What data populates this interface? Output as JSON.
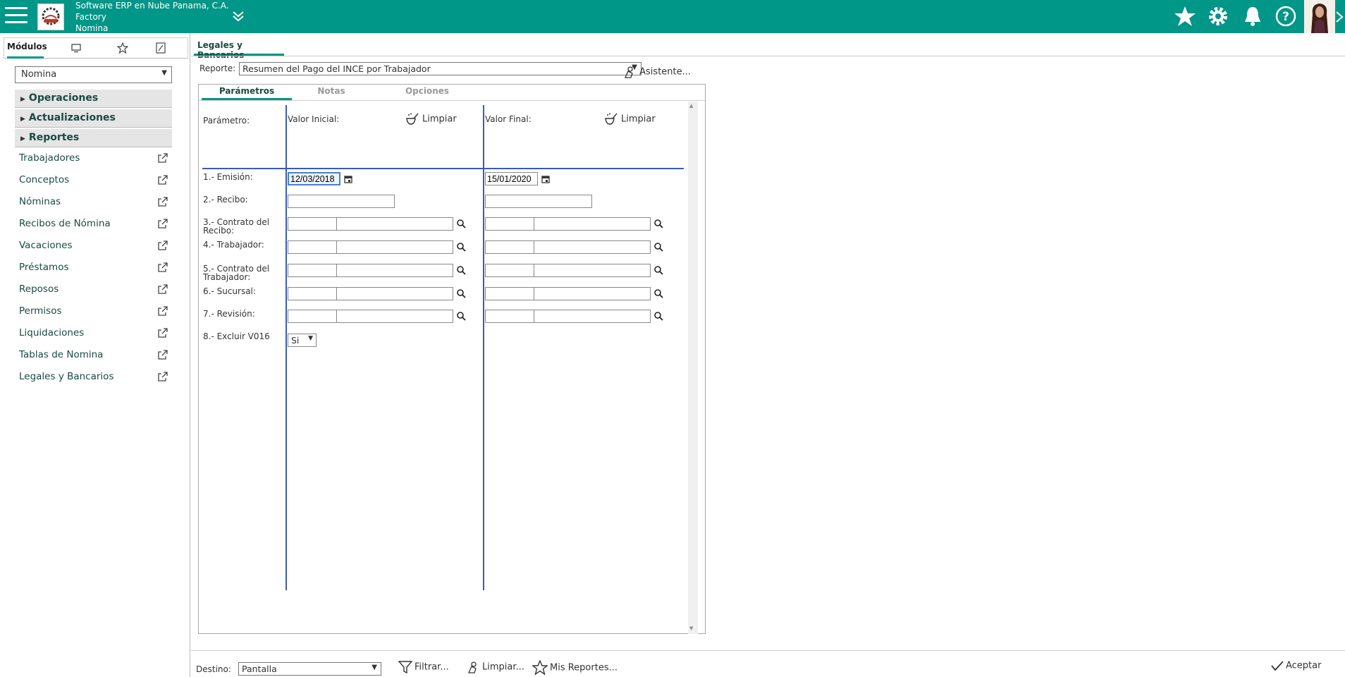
{
  "header": {
    "company_line1": "Software ERP en Nube Panama, C.A.",
    "company_line2": "Factory",
    "company_line3": "Nomina",
    "accent": "#009688"
  },
  "sidebar": {
    "tabs": [
      "Módulos",
      "monitor-icon",
      "star-icon",
      "edit-icon"
    ],
    "active_tab_label": "Módulos",
    "module_select": "Nomina",
    "sections": [
      "Operaciones",
      "Actualizaciones",
      "Reportes"
    ],
    "items": [
      {
        "label": "Trabajadores"
      },
      {
        "label": "Conceptos"
      },
      {
        "label": "Nóminas"
      },
      {
        "label": "Recibos de Nómina"
      },
      {
        "label": "Vacaciones"
      },
      {
        "label": "Préstamos"
      },
      {
        "label": "Reposos"
      },
      {
        "label": "Permisos"
      },
      {
        "label": "Liquidaciones"
      },
      {
        "label": "Tablas de Nomina"
      },
      {
        "label": "Legales y Bancarios"
      }
    ]
  },
  "main": {
    "tab_title": "Legales y Bancarios",
    "report_label": "Reporte:",
    "report_value": "Resumen del Pago del INCE por Trabajador",
    "asistente_label": "Asistente...",
    "panel_tabs": [
      "Parámetros",
      "Notas",
      "Opciones"
    ],
    "param_header": "Parámetro:",
    "initial_header": "Valor Inicial:",
    "final_header": "Valor Final:",
    "clear_label": "Limpiar",
    "params": [
      {
        "label": "1.- Emisión:",
        "initial": "12/03/2018",
        "final": "15/01/2020"
      },
      {
        "label": "2.- Recibo:"
      },
      {
        "label": "3.- Contrato del Recibo:"
      },
      {
        "label": "4.- Trabajador:"
      },
      {
        "label": "5.- Contrato del Trabajador:"
      },
      {
        "label": "6.- Sucursal:"
      },
      {
        "label": "7.- Revisión:"
      },
      {
        "label": "8.- Excluir V016",
        "value": "Si"
      }
    ]
  },
  "footer": {
    "destino_label": "Destino:",
    "destino_value": "Pantalla",
    "filtrar_label": "Filtrar...",
    "limpiar_label": "Limpiar...",
    "mis_reportes_label": "Mis Reportes...",
    "aceptar_label": "Aceptar"
  }
}
